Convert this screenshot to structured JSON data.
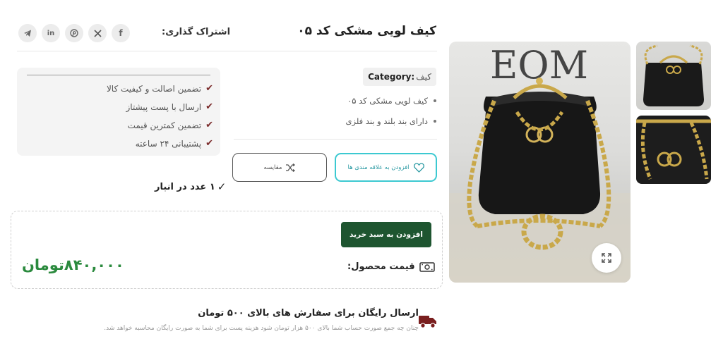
{
  "product": {
    "title": "کیف لویی مشکی کد ۰۵",
    "category_key": "Category:",
    "category_value": "کیف",
    "features": [
      "کیف لویی مشکی کد ۰۵",
      "دارای بند بلند و بند فلزی"
    ]
  },
  "share": {
    "label": "اشتراک گذاری:",
    "icons": [
      "facebook-icon",
      "x-icon",
      "pinterest-icon",
      "linkedin-icon",
      "telegram-icon"
    ]
  },
  "actions": {
    "wishlist_label": "افزودن به علاقه مندی ها",
    "compare_label": "مقایسه"
  },
  "guarantees": [
    "تضمین اصالت و کیفیت کالا",
    "ارسال با پست پیشتاز",
    "تضمین کمترین قیمت",
    "پشتیبانی ۲۴ ساعته"
  ],
  "stock": {
    "text": "۱ عدد در انبار"
  },
  "purchase": {
    "add_to_cart_label": "افزودن به سبد خرید",
    "price_label": "قیمت محصول:",
    "price_value": "۸۴۰,۰۰۰تومان"
  },
  "shipping": {
    "title": "ارسال رایگان برای سفارش های بالای ۵۰۰ تومان",
    "description": "چنان چه جمع صورت حساب شما بالای ۵۰۰ هزار تومان شود هزینه پست برای شما به صورت رایگان محاسبه خواهد شد."
  },
  "colors": {
    "accent_green": "#1e5530",
    "price_green": "#2b8a3e",
    "wishlist_teal": "#3cc9d1",
    "check_maroon": "#7a2a2a"
  }
}
